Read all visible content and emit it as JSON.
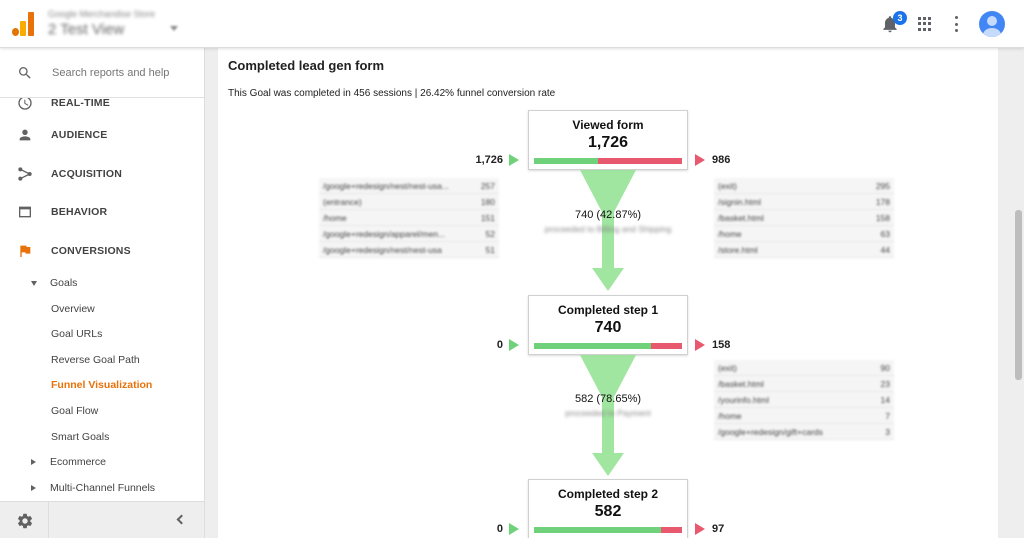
{
  "header": {
    "property_name": "Google Merchandise Store",
    "view_name": "2 Test View",
    "notification_count": "3"
  },
  "sidebar": {
    "search_placeholder": "Search reports and help",
    "items": [
      {
        "label": "REAL-TIME",
        "icon": "clock-icon"
      },
      {
        "label": "AUDIENCE",
        "icon": "person-icon"
      },
      {
        "label": "ACQUISITION",
        "icon": "acquisition-icon"
      },
      {
        "label": "BEHAVIOR",
        "icon": "behavior-icon"
      },
      {
        "label": "CONVERSIONS",
        "icon": "flag-icon"
      }
    ],
    "goals_label": "Goals",
    "goals_sub": [
      "Overview",
      "Goal URLs",
      "Reverse Goal Path",
      "Funnel Visualization",
      "Goal Flow",
      "Smart Goals"
    ],
    "active_sub": "Funnel Visualization",
    "ecommerce_label": "Ecommerce",
    "multichannel_label": "Multi-Channel Funnels"
  },
  "main": {
    "title": "Completed lead gen form",
    "summary": "This Goal was completed in 456 sessions | 26.42% funnel conversion rate",
    "steps": [
      {
        "name": "Viewed form",
        "count": "1,726",
        "entrances": "1,726",
        "exits": "986",
        "conversion_fraction": 0.43,
        "entrance_sources": [
          {
            "page": "/google+redesign/nest/nest-usa...",
            "value": "257"
          },
          {
            "page": "(entrance)",
            "value": "180"
          },
          {
            "page": "/home",
            "value": "151"
          },
          {
            "page": "/google+redesign/apparel/men...",
            "value": "52"
          },
          {
            "page": "/google+redesign/nest/nest-usa",
            "value": "51"
          }
        ],
        "exit_pages": [
          {
            "page": "(exit)",
            "value": "295"
          },
          {
            "page": "/signin.html",
            "value": "178"
          },
          {
            "page": "/basket.html",
            "value": "158"
          },
          {
            "page": "/home",
            "value": "63"
          },
          {
            "page": "/store.html",
            "value": "44"
          }
        ]
      },
      {
        "name": "Completed step 1",
        "count": "740",
        "entrances": "0",
        "exits": "158",
        "conversion_fraction": 0.79,
        "exit_pages": [
          {
            "page": "(exit)",
            "value": "90"
          },
          {
            "page": "/basket.html",
            "value": "23"
          },
          {
            "page": "/yourinfo.html",
            "value": "14"
          },
          {
            "page": "/home",
            "value": "7"
          },
          {
            "page": "/google+redesign/gift+cards",
            "value": "3"
          }
        ]
      },
      {
        "name": "Completed step 2",
        "count": "582",
        "entrances": "0",
        "exits": "97",
        "conversion_fraction": 0.86
      }
    ],
    "transitions": [
      {
        "value": "740 (42.87%)",
        "label": "proceeded to Billing and Shipping"
      },
      {
        "value": "582 (78.65%)",
        "label": "proceeded to Payment"
      }
    ]
  },
  "colors": {
    "accent_orange": "#e8710a",
    "funnel_green": "#6fd27a",
    "exit_red": "#e8596f",
    "notification_blue": "#1a73e8"
  }
}
